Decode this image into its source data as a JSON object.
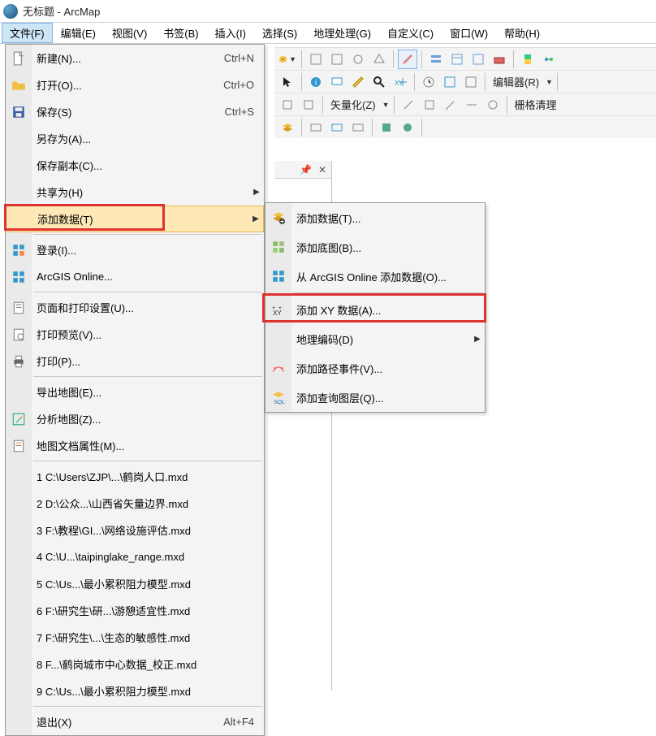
{
  "window": {
    "title": "无标题 - ArcMap"
  },
  "menubar": [
    "文件(F)",
    "编辑(E)",
    "视图(V)",
    "书签(B)",
    "插入(I)",
    "选择(S)",
    "地理处理(G)",
    "自定义(C)",
    "窗口(W)",
    "帮助(H)"
  ],
  "toolbar": {
    "vectorize": "矢量化(Z)",
    "rasterCleanup": "栅格清理",
    "editor": "编辑器(R)"
  },
  "fileMenu": {
    "new": {
      "label": "新建(N)...",
      "shortcut": "Ctrl+N"
    },
    "open": {
      "label": "打开(O)...",
      "shortcut": "Ctrl+O"
    },
    "save": {
      "label": "保存(S)",
      "shortcut": "Ctrl+S"
    },
    "saveAs": {
      "label": "另存为(A)..."
    },
    "saveCopy": {
      "label": "保存副本(C)..."
    },
    "shareAs": {
      "label": "共享为(H)"
    },
    "addData": {
      "label": "添加数据(T)"
    },
    "signIn": {
      "label": "登录(I)..."
    },
    "arcgisOnline": {
      "label": "ArcGIS Online..."
    },
    "pagePrint": {
      "label": "页面和打印设置(U)..."
    },
    "printPreview": {
      "label": "打印预览(V)..."
    },
    "print": {
      "label": "打印(P)..."
    },
    "exportMap": {
      "label": "导出地图(E)..."
    },
    "analyzeMap": {
      "label": "分析地图(Z)..."
    },
    "docProps": {
      "label": "地图文档属性(M)..."
    },
    "recent": [
      "1 C:\\Users\\ZJP\\...\\鹤岗人口.mxd",
      "2 D:\\公众...\\山西省矢量边界.mxd",
      "3 F:\\教程\\GI...\\网络设施评估.mxd",
      "4 C:\\U...\\taipinglake_range.mxd",
      "5 C:\\Us...\\最小累积阻力模型.mxd",
      "6 F:\\研究生\\研...\\游憩适宜性.mxd",
      "7 F:\\研究生\\...\\生态的敏感性.mxd",
      "8 F...\\鹤岗城市中心数据_校正.mxd",
      "9 C:\\Us...\\最小累积阻力模型.mxd"
    ],
    "exit": {
      "label": "退出(X)",
      "shortcut": "Alt+F4"
    }
  },
  "subMenu": {
    "addData": "添加数据(T)...",
    "addBasemap": "添加底图(B)...",
    "addFromOnline": "从 ArcGIS Online 添加数据(O)...",
    "addXY": "添加 XY 数据(A)...",
    "geocoding": "地理编码(D)",
    "addRouteEvents": "添加路径事件(V)...",
    "addQueryLayer": "添加查询图层(Q)..."
  }
}
